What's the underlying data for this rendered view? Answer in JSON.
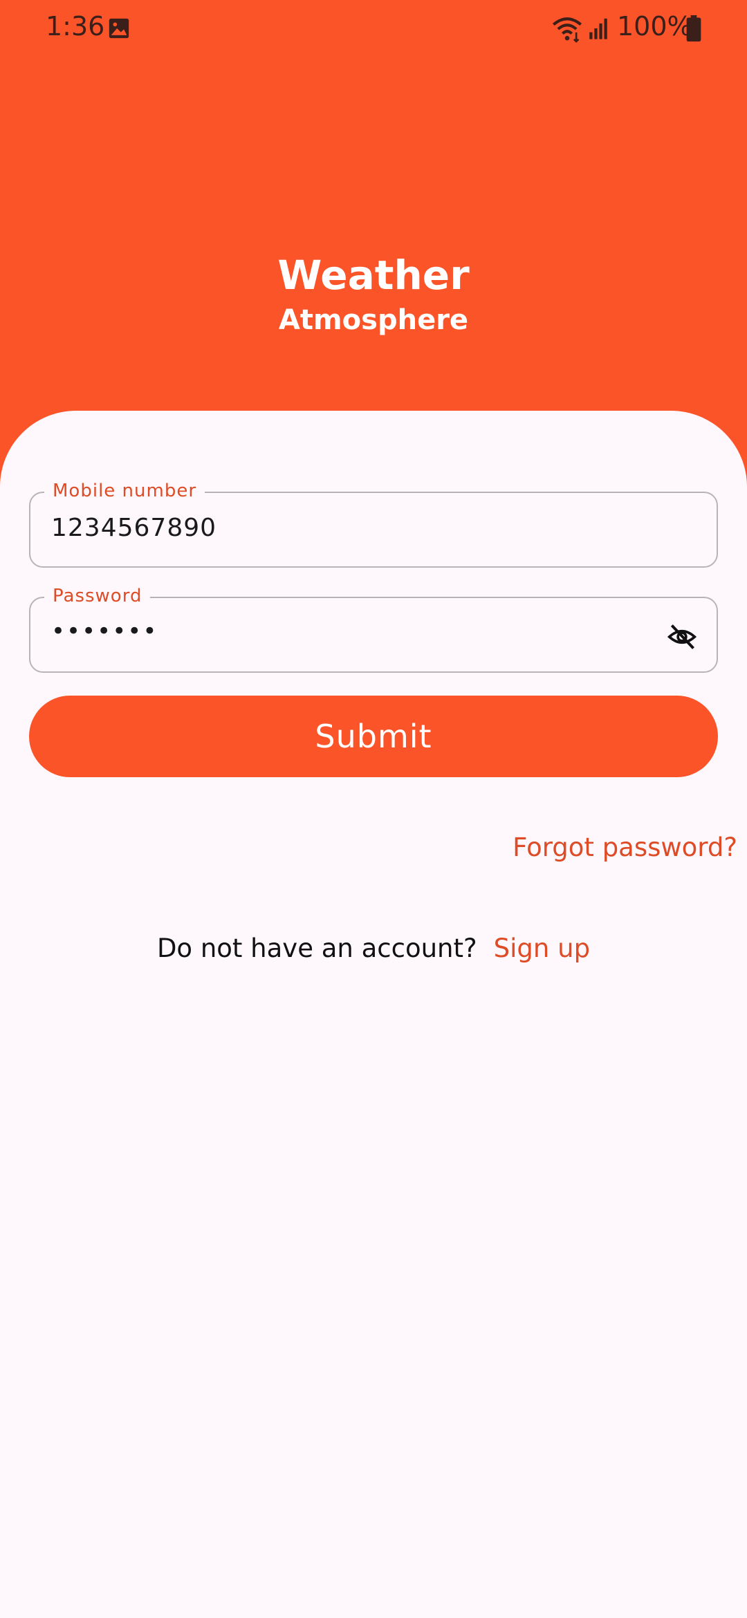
{
  "status_bar": {
    "time": "1:36",
    "battery": "100%",
    "icons": [
      "gallery-icon",
      "wifi-icon",
      "signal-icon",
      "battery-icon"
    ]
  },
  "header": {
    "title": "Weather",
    "subtitle": "Atmosphere",
    "background_color": "#fc5429"
  },
  "form": {
    "mobile": {
      "label": "Mobile number",
      "value": "1234567890"
    },
    "password": {
      "label": "Password",
      "value": "•••••••",
      "toggle_icon": "eye-off-icon"
    },
    "submit_label": "Submit",
    "forgot_label": "Forgot password?"
  },
  "signup": {
    "prompt": "Do not have an account?",
    "link_label": "Sign up"
  },
  "colors": {
    "accent": "#fc5429",
    "link": "#dd4c26",
    "background": "#fef8fc"
  }
}
